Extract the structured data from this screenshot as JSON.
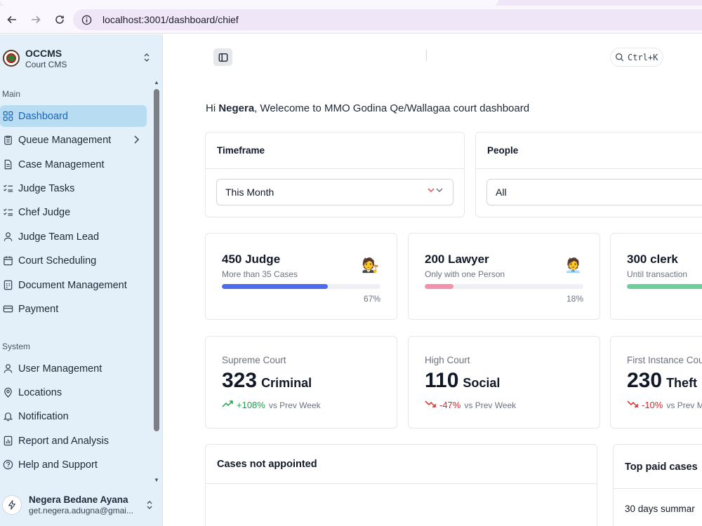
{
  "browser": {
    "url": "localhost:3001/dashboard/chief"
  },
  "sidebar": {
    "brand": {
      "title": "OCCMS",
      "subtitle": "Court CMS"
    },
    "sections": {
      "main": "Main",
      "system": "System"
    },
    "main_items": [
      {
        "label": "Dashboard",
        "icon": "dashboard-icon",
        "active": true
      },
      {
        "label": "Queue Management",
        "icon": "clipboard-icon",
        "has_submenu": true
      },
      {
        "label": "Case Management",
        "icon": "file-icon"
      },
      {
        "label": "Judge Tasks",
        "icon": "list-check-icon"
      },
      {
        "label": "Chef Judge",
        "icon": "list-check-icon"
      },
      {
        "label": "Judge Team Lead",
        "icon": "user-icon"
      },
      {
        "label": "Court Scheduling",
        "icon": "calendar-icon"
      },
      {
        "label": "Document Management",
        "icon": "document-icon"
      },
      {
        "label": "Payment",
        "icon": "card-icon"
      }
    ],
    "system_items": [
      {
        "label": "User Management",
        "icon": "user-icon"
      },
      {
        "label": "Locations",
        "icon": "location-pin-icon"
      },
      {
        "label": "Notification",
        "icon": "bell-icon"
      },
      {
        "label": "Report and Analysis",
        "icon": "report-icon"
      },
      {
        "label": "Help and Support",
        "icon": "help-icon"
      }
    ],
    "user": {
      "name": "Negera Bedane Ayana",
      "email": "get.negera.adugna@gmai..."
    }
  },
  "header": {
    "search_shortcut": "Ctrl+K"
  },
  "greeting": {
    "prefix": "Hi ",
    "name": "Negera",
    "suffix": ", Welecome to MMO Godina Qe/Wallagaa court dashboard"
  },
  "filters": [
    {
      "title": "Timeframe",
      "value": "This Month"
    },
    {
      "title": "People",
      "value": "All"
    }
  ],
  "stats": [
    {
      "title": "450 Judge",
      "subtitle": "More than 35 Cases",
      "emoji": "🧑‍⚖️",
      "percent_label": "67%",
      "progress": 0.67,
      "color": "#4f6bed"
    },
    {
      "title": "200 Lawyer",
      "subtitle": "Only with one Person",
      "emoji": "🧑‍💼",
      "percent_label": "18%",
      "progress": 0.18,
      "color": "#f492ad"
    },
    {
      "title": "300 clerk",
      "subtitle": "Until transaction",
      "emoji": "",
      "percent_label": "",
      "progress": 0.55,
      "color": "#6ccf9c"
    }
  ],
  "courts": [
    {
      "label": "Supreme Court",
      "value": "323",
      "kind": "Criminal",
      "trend": "+108%",
      "direction": "up",
      "vs": "vs Prev Week"
    },
    {
      "label": "High Court",
      "value": "110",
      "kind": "Social",
      "trend": "-47%",
      "direction": "down",
      "vs": "vs Prev Week"
    },
    {
      "label": "First Instance Cou",
      "value": "230",
      "kind": "Theft",
      "trend": "-10%",
      "direction": "down",
      "vs": "vs Prev M"
    }
  ],
  "bottom": {
    "cases_not_appointed": "Cases not appointed",
    "top_paid": "Top paid cases",
    "summary": "30 days summar"
  }
}
